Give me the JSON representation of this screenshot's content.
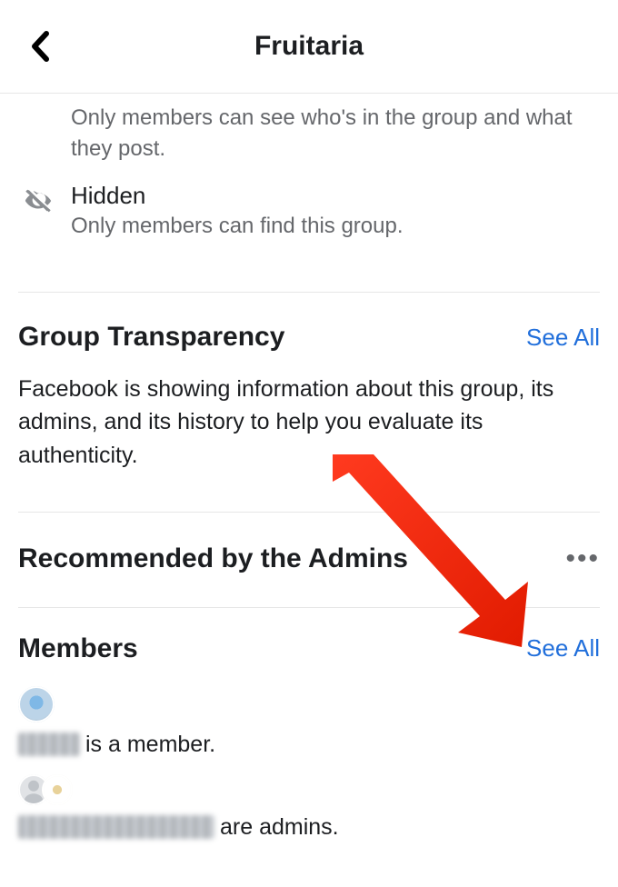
{
  "header": {
    "title": "Fruitaria"
  },
  "privacy": {
    "members_only_desc": "Only members can see who's in the group and what they post.",
    "hidden_title": "Hidden",
    "hidden_desc": "Only members can find this group."
  },
  "transparency": {
    "title": "Group Transparency",
    "see_all": "See All",
    "body": "Facebook is showing information about this group, its admins, and its history to help you evaluate its authenticity."
  },
  "recommended": {
    "title": "Recommended by the Admins",
    "more": "•••"
  },
  "members": {
    "title": "Members",
    "see_all": "See All",
    "line1_suffix": " is a member.",
    "line2_suffix": " are admins."
  }
}
